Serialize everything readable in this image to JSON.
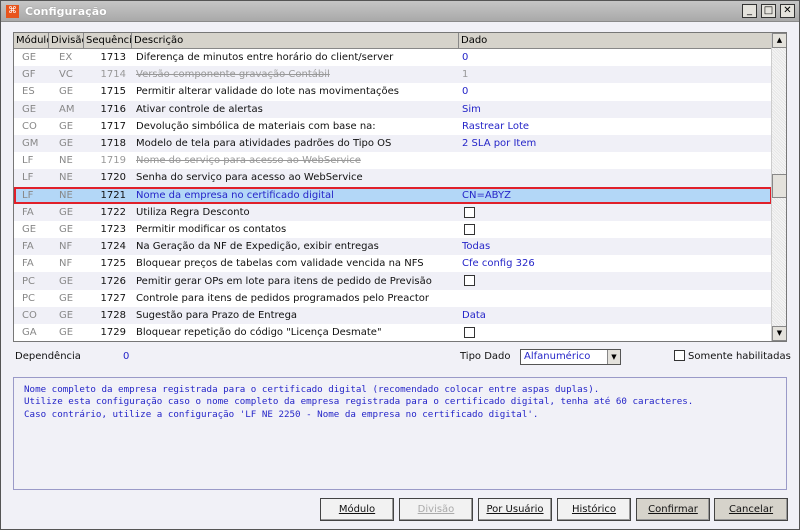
{
  "window": {
    "title": "Configuração",
    "minimize": "_",
    "maximize": "□",
    "close": "✕"
  },
  "grid": {
    "headers": [
      "Módulo",
      "Divisão",
      "Sequência",
      "Descrição",
      "Dado"
    ],
    "rows": [
      {
        "modulo": "GE",
        "divisao": "EX",
        "seq": "1713",
        "desc": "Diferença de minutos entre horário do client/server",
        "dado": "0"
      },
      {
        "modulo": "GF",
        "divisao": "VC",
        "seq": "1714",
        "desc": "Versão componente gravação Contábil",
        "dado": "1",
        "disabled": true
      },
      {
        "modulo": "ES",
        "divisao": "GE",
        "seq": "1715",
        "desc": "Permitir alterar validade do lote nas movimentações",
        "dado": "0"
      },
      {
        "modulo": "GE",
        "divisao": "AM",
        "seq": "1716",
        "desc": "Ativar controle de alertas",
        "dado": "Sim"
      },
      {
        "modulo": "CO",
        "divisao": "GE",
        "seq": "1717",
        "desc": "Devolução simbólica de materiais com base na:",
        "dado": "Rastrear Lote"
      },
      {
        "modulo": "GM",
        "divisao": "GE",
        "seq": "1718",
        "desc": "Modelo de tela para atividades padrões do Tipo OS",
        "dado": "2 SLA por Item"
      },
      {
        "modulo": "LF",
        "divisao": "NE",
        "seq": "1719",
        "desc": "Nome do serviço para acesso ao WebService",
        "dado": "",
        "disabled": true
      },
      {
        "modulo": "LF",
        "divisao": "NE",
        "seq": "1720",
        "desc": "Senha do serviço para acesso ao WebService",
        "dado": ""
      },
      {
        "modulo": "LF",
        "divisao": "NE",
        "seq": "1721",
        "desc": "Nome da empresa no certificado digital",
        "dado": "CN=ABYZ",
        "selected": true
      },
      {
        "modulo": "FA",
        "divisao": "GE",
        "seq": "1722",
        "desc": "Utiliza Regra Desconto",
        "checkbox": true
      },
      {
        "modulo": "GE",
        "divisao": "GE",
        "seq": "1723",
        "desc": "Permitir modificar os contatos",
        "checkbox": true
      },
      {
        "modulo": "FA",
        "divisao": "NF",
        "seq": "1724",
        "desc": "Na Geração da NF de Expedição, exibir entregas",
        "dado": " Todas"
      },
      {
        "modulo": "FA",
        "divisao": "NF",
        "seq": "1725",
        "desc": "Bloquear preços de tabelas com validade vencida na NFS",
        "dado": "Cfe config 326"
      },
      {
        "modulo": "PC",
        "divisao": "GE",
        "seq": "1726",
        "desc": "Pemitir gerar OPs em lote para itens de pedido de Previsão",
        "checkbox": true
      },
      {
        "modulo": "PC",
        "divisao": "GE",
        "seq": "1727",
        "desc": "Controle para itens de pedidos programados pelo Preactor",
        "dado": ""
      },
      {
        "modulo": "CO",
        "divisao": "GE",
        "seq": "1728",
        "desc": "Sugestão para Prazo de Entrega",
        "dado": "Data"
      },
      {
        "modulo": "GA",
        "divisao": "GE",
        "seq": "1729",
        "desc": "Bloquear repetição do código \"Licença Desmate\"",
        "checkbox": true
      }
    ]
  },
  "footer": {
    "dependencia_label": "Dependência",
    "dependencia_value": "0",
    "tipo_dado_label": "Tipo Dado",
    "tipo_dado_value": "Alfanumérico",
    "somente_label": "Somente habilitadas"
  },
  "description": "Nome completo da empresa registrada para o certificado digital (recomendado colocar entre aspas duplas).\nUtilize esta configuração caso o nome completo da empresa registrada para o certificado digital, tenha até 60 caracteres.\nCaso contrário, utilize a configuração 'LF NE 2250 - Nome da empresa no certificado digital'.",
  "buttons": {
    "modulo": "Módulo",
    "divisao": "Divisão",
    "por_usuario": "Por Usuário",
    "historico": "Histórico",
    "confirmar": "Confirmar",
    "cancelar": "Cancelar"
  }
}
